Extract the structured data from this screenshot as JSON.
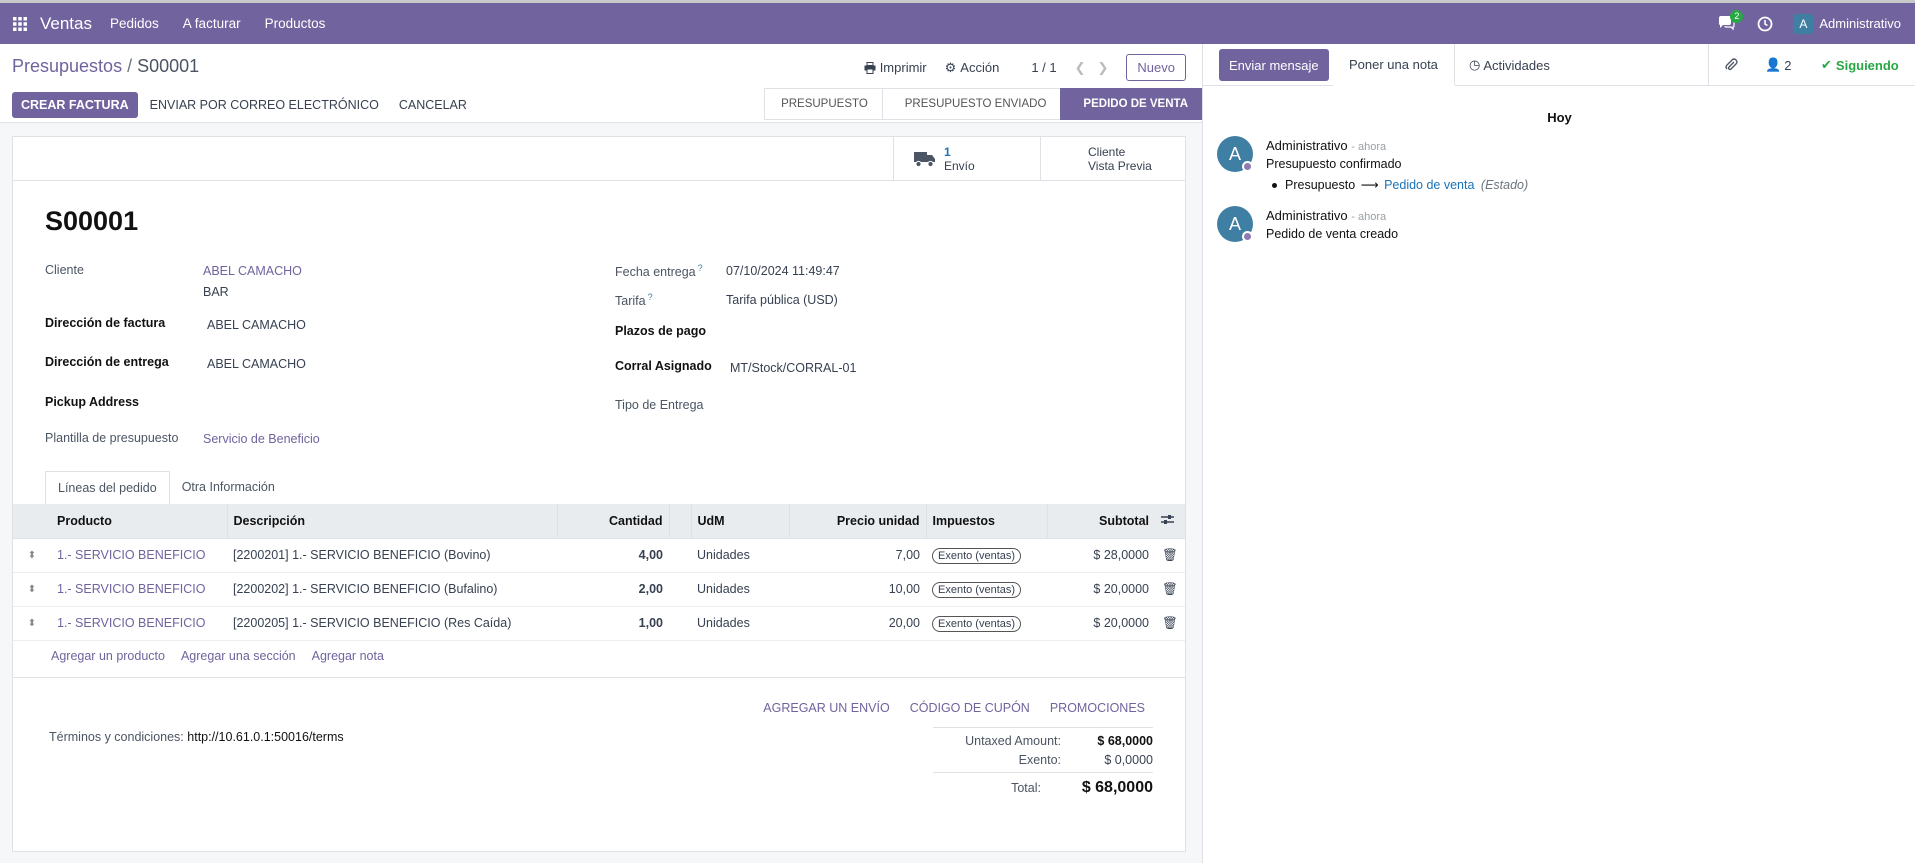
{
  "nav": {
    "brand": "Ventas",
    "menus": [
      "Pedidos",
      "A facturar",
      "Productos"
    ],
    "chat_count": "2",
    "user_initial": "A",
    "user_name": "Administrativo"
  },
  "breadcrumb": {
    "parent": "Presupuestos",
    "sep": "/",
    "current": "S00001"
  },
  "control": {
    "print": "Imprimir",
    "action": "Acción",
    "pager": "1 / 1",
    "new": "Nuevo"
  },
  "buttons": {
    "invoice": "CREAR FACTURA",
    "email": "ENVIAR POR CORREO ELECTRÓNICO",
    "cancel": "CANCELAR"
  },
  "status": [
    "PRESUPUESTO",
    "PRESUPUESTO ENVIADO",
    "PEDIDO DE VENTA"
  ],
  "smart": {
    "delivery_count": "1",
    "delivery_label": "Envío",
    "preview_l1": "Cliente",
    "preview_l2": "Vista Previa"
  },
  "form": {
    "name": "S00001",
    "customer_label": "Cliente",
    "customer_name": "ABEL CAMACHO",
    "customer_sub": "BAR",
    "invoice_addr_label": "Dirección de factura",
    "invoice_addr": "ABEL CAMACHO",
    "delivery_addr_label": "Dirección de entrega",
    "delivery_addr": "ABEL CAMACHO",
    "pickup_label": "Pickup Address",
    "template_label": "Plantilla de presupuesto",
    "template": "Servicio de Beneficio",
    "date_label": "Fecha entrega",
    "date": "07/10/2024 11:49:47",
    "tarifa_label": "Tarifa",
    "tarifa": "Tarifa pública (USD)",
    "payment_label": "Plazos de pago",
    "corral_label": "Corral Asignado",
    "corral": "MT/Stock/CORRAL-01",
    "delivery_type_label": "Tipo de Entrega",
    "help_mark": "?"
  },
  "tabs": [
    "Líneas del pedido",
    "Otra Información"
  ],
  "columns": [
    "Producto",
    "Descripción",
    "Cantidad",
    "UdM",
    "Precio unidad",
    "Impuestos",
    "Subtotal"
  ],
  "rows": [
    {
      "product": "1.- SERVICIO BENEFICIO",
      "desc": "[2200201] 1.- SERVICIO BENEFICIO (Bovino)",
      "qty": "4,00",
      "uom": "Unidades",
      "price": "7,00",
      "tax": "Exento (ventas)",
      "subtotal": "$ 28,0000"
    },
    {
      "product": "1.- SERVICIO BENEFICIO",
      "desc": "[2200202] 1.- SERVICIO BENEFICIO (Bufalino)",
      "qty": "2,00",
      "uom": "Unidades",
      "price": "10,00",
      "tax": "Exento (ventas)",
      "subtotal": "$ 20,0000"
    },
    {
      "product": "1.- SERVICIO BENEFICIO",
      "desc": "[2200205] 1.- SERVICIO BENEFICIO (Res Caída)",
      "qty": "1,00",
      "uom": "Unidades",
      "price": "20,00",
      "tax": "Exento (ventas)",
      "subtotal": "$ 20,0000"
    }
  ],
  "add_links": [
    "Agregar un producto",
    "Agregar una sección",
    "Agregar nota"
  ],
  "promos": [
    "AGREGAR UN ENVÍO",
    "CÓDIGO DE CUPÓN",
    "PROMOCIONES"
  ],
  "terms": {
    "label": "Términos y condiciones:",
    "url": "http://10.61.0.1:50016/terms"
  },
  "totals": {
    "untaxed_label": "Untaxed Amount:",
    "untaxed": "$ 68,0000",
    "exento_label": "Exento:",
    "exento": "$ 0,0000",
    "total_label": "Total:",
    "total": "$ 68,0000"
  },
  "chatter": {
    "send": "Enviar mensaje",
    "note": "Poner una nota",
    "activities": "Actividades",
    "followers": "2",
    "following": "Siguiendo",
    "today": "Hoy",
    "messages": [
      {
        "initial": "A",
        "author": "Administrativo",
        "time": "- ahora",
        "body": "Presupuesto confirmado",
        "from": "Presupuesto",
        "to": "Pedido de venta",
        "field": "(Estado)"
      },
      {
        "initial": "A",
        "author": "Administrativo",
        "time": "- ahora",
        "body": "Pedido de venta creado"
      }
    ]
  }
}
